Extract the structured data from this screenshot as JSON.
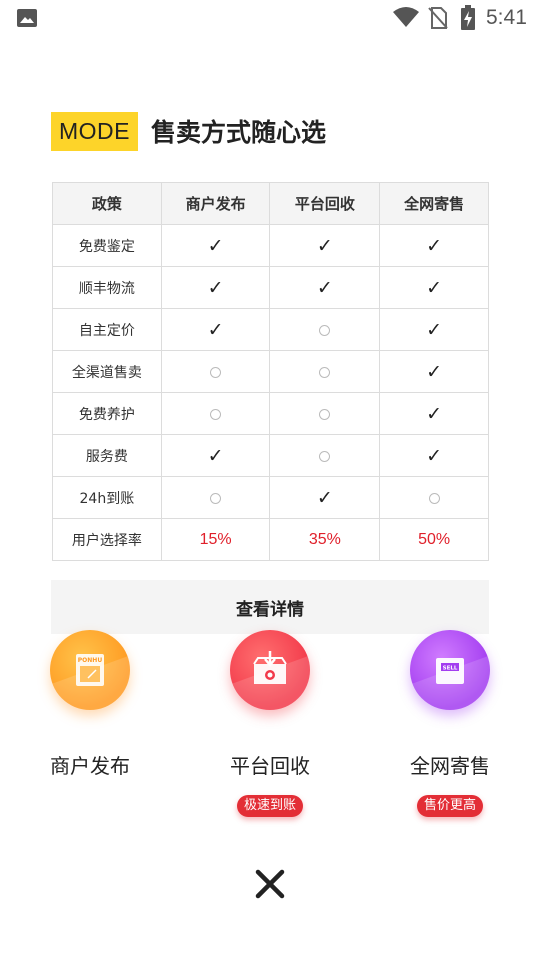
{
  "status_bar": {
    "time": "5:41",
    "icons": [
      "image-icon",
      "wifi-icon",
      "no-sim-icon",
      "battery-charging-icon"
    ]
  },
  "heading": {
    "badge": "MODE",
    "title": "售卖方式随心选"
  },
  "table": {
    "headers": [
      "政策",
      "商户发布",
      "平台回收",
      "全网寄售"
    ],
    "rows": [
      {
        "label": "免费鉴定",
        "values": [
          "check",
          "check",
          "check"
        ]
      },
      {
        "label": "顺丰物流",
        "values": [
          "check",
          "check",
          "check"
        ]
      },
      {
        "label": "自主定价",
        "values": [
          "check",
          "circle",
          "check"
        ]
      },
      {
        "label": "全渠道售卖",
        "values": [
          "circle",
          "circle",
          "check"
        ]
      },
      {
        "label": "免费养护",
        "values": [
          "circle",
          "circle",
          "check"
        ]
      },
      {
        "label": "服务费",
        "values": [
          "check",
          "circle",
          "check"
        ]
      },
      {
        "label": "24h到账",
        "values": [
          "circle",
          "check",
          "circle"
        ]
      }
    ],
    "rate_row": {
      "label": "用户选择率",
      "values": [
        "15%",
        "35%",
        "50%"
      ]
    },
    "check_glyph": "✓",
    "rate_color": "#e0202b"
  },
  "details_button": "查看详情",
  "options": [
    {
      "label": "商户发布",
      "icon": "ponhu-box-icon",
      "icon_text": "PONHU",
      "tag": ""
    },
    {
      "label": "平台回收",
      "icon": "recycle-box-icon",
      "icon_text": "",
      "tag": "极速到账"
    },
    {
      "label": "全网寄售",
      "icon": "sell-card-icon",
      "icon_text": "SELL",
      "tag": "售价更高"
    }
  ],
  "colors": {
    "badge": "#fdd429",
    "orange": "#ff9a22",
    "red": "#f2394a",
    "purple": "#a33df0",
    "tag": "#e32e36"
  },
  "close_icon": "close-icon"
}
